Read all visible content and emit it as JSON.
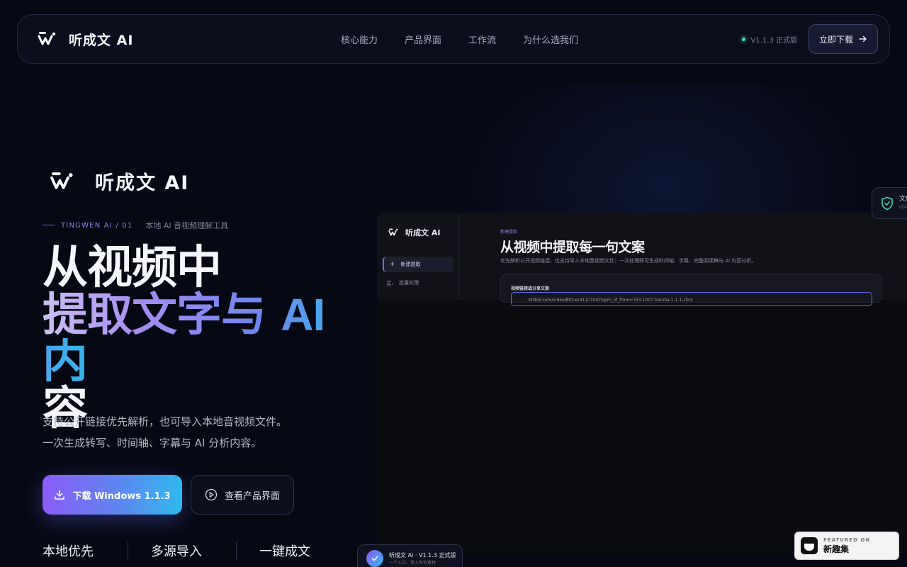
{
  "nav": {
    "brand": "听成文 AI",
    "links": [
      "核心能力",
      "产品界面",
      "工作流",
      "为什么选我们"
    ],
    "version": "V1.1.3 正式版",
    "download_label": "立即下载"
  },
  "hero": {
    "brand": "听成文 AI",
    "eyebrow_code": "TINGWEN AI / 01",
    "eyebrow_text": "本地 AI 音视频理解工具",
    "headline_1": "从视频中",
    "headline_2a": "提取文字与 ",
    "headline_2b": "AI",
    "headline_2c": " 内",
    "headline_3": "容",
    "sub_1": "支持公开链接优先解析，也可导入本地音视频文件。",
    "sub_2": "一次生成转写、时间轴、字幕与 AI 分析内容。",
    "cta_primary": "下载 Windows 1.1.3",
    "cta_secondary": "查看产品界面",
    "stats": [
      "本地优先",
      "多源导入",
      "一键成文"
    ]
  },
  "preview": {
    "brand": "听成文 AI",
    "nav_active": "新建提取",
    "nav_item": "批量处理",
    "tag": "新建提取",
    "title": "从视频中提取每一句文案",
    "desc": "优先解析公开视频链接，也支持导入本地音视频文件；一次处理即可生成时间轴、字幕、完整阅读稿与 AI 内容分析。",
    "card_label": "视频链接或分享文案",
    "input_value": "bilibili.com/video/BV1xx411c7mD?spm_id_from=333.1007.tianma.1-1-1.click"
  },
  "badge": {
    "title": "文件",
    "sub": "LOCAL"
  },
  "toast": {
    "title": "听成文 AI · V1.1.3 正式版",
    "sub": "一个入口，导入所有素材"
  },
  "featured": {
    "kicker": "FEATURED ON",
    "name": "新趣集"
  },
  "colors": {
    "accent_purple": "#8b5cf6",
    "accent_blue": "#2fb9ee",
    "status_green": "#3fe0b5",
    "background": "#060814"
  }
}
